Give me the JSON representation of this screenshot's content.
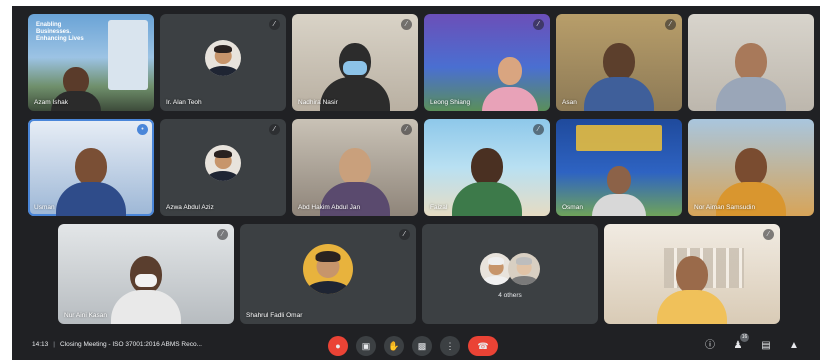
{
  "participants": [
    {
      "name": "Azam Ishak",
      "banner": "Enabling Businesses. Enhancing Lives"
    },
    {
      "name": "Ir. Alan Teoh"
    },
    {
      "name": "Nadhira Nasir"
    },
    {
      "name": "Leong Shiang"
    },
    {
      "name": "Asan"
    },
    {
      "name": ""
    },
    {
      "name": "Usman"
    },
    {
      "name": "Azwa Abdul Aziz"
    },
    {
      "name": "Abd Hakim Abdul Jan"
    },
    {
      "name": "Faizal"
    },
    {
      "name": "Osman"
    },
    {
      "name": "Nor Aiman Samsudin"
    },
    {
      "name": "Nur Aini Kasan"
    },
    {
      "name": "Shahrul Fadli Omar"
    },
    {
      "name": "4 others"
    },
    {
      "name": ""
    }
  ],
  "bottom_bar": {
    "time": "14:13",
    "meeting_title": "Closing Meeting - ISO 37001:2016 ABMS Reco...",
    "people_count": "16"
  },
  "colors": {
    "background": "#202124",
    "tile": "#3c4043",
    "danger": "#ea4335",
    "text": "#e8eaed"
  },
  "icons": {
    "mic_off": "mic-off-icon",
    "camera": "camera-icon",
    "raise_hand": "raise-hand-icon",
    "present": "present-screen-icon",
    "more": "more-options-icon",
    "hang_up": "hang-up-icon",
    "info": "info-icon",
    "people": "people-icon",
    "chat": "chat-icon",
    "activities": "activities-icon"
  }
}
